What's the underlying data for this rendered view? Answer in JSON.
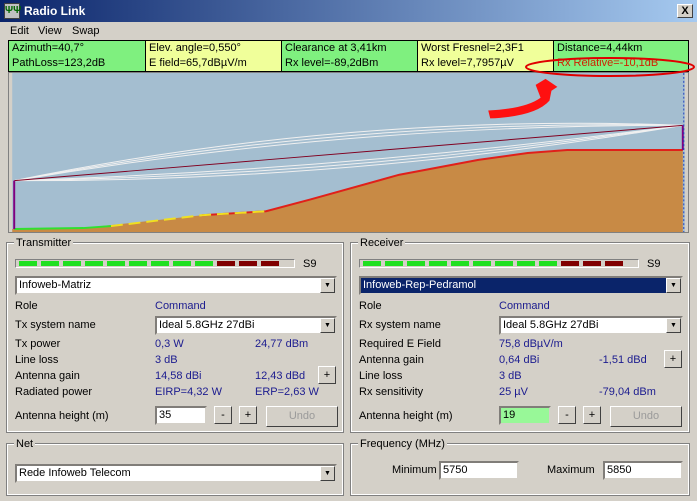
{
  "window": {
    "title": "Radio Link",
    "close": "X"
  },
  "menu": [
    "Edit",
    "View",
    "Swap"
  ],
  "info": {
    "row1": [
      "Azimuth=40,7°",
      "Elev. angle=0,550°",
      "Clearance at 3,41km",
      "Worst Fresnel=2,3F1",
      "Distance=4,44km"
    ],
    "row2": [
      "PathLoss=123,2dB",
      "E field=65,7dBµV/m",
      "Rx level=-89,2dBm",
      "Rx level=7,7957µV",
      "Rx Relative=-10,1dB"
    ]
  },
  "colors": {
    "sky": "#a4bed0",
    "terrain": "#c88a45",
    "terrain_line": "#e0201a",
    "annotation": "#ff0000"
  },
  "transmitter": {
    "legend": "Transmitter",
    "meter_label": "S9",
    "meter_green": 9,
    "meter_red": 3,
    "site": "Infoweb-Matriz",
    "role_label": "Role",
    "role": "Command",
    "system_label": "Tx system name",
    "system": "Ideal 5.8GHz 27dBi",
    "power_label": "Tx power",
    "power_w": "0,3 W",
    "power_dbm": "24,77 dBm",
    "loss_label": "Line loss",
    "loss": "3 dB",
    "gain_label": "Antenna gain",
    "gain_dbi": "14,58 dBi",
    "gain_dbd": "12,43 dBd",
    "rad_label": "Radiated power",
    "eirp": "EIRP=4,32 W",
    "erp": "ERP=2,63 W",
    "height_label": "Antenna height (m)",
    "height": "35",
    "minus": "-",
    "plus": "+",
    "undo": "Undo"
  },
  "receiver": {
    "legend": "Receiver",
    "meter_label": "S9",
    "meter_green": 9,
    "meter_red": 3,
    "site": "Infoweb-Rep-Pedramol",
    "role_label": "Role",
    "role": "Command",
    "system_label": "Rx system name",
    "system": "Ideal 5.8GHz 27dBi",
    "field_label": "Required E Field",
    "field": "75,8 dBµV/m",
    "gain_label": "Antenna gain",
    "gain_dbi": "0,64 dBi",
    "gain_dbd": "-1,51 dBd",
    "loss_label": "Line loss",
    "loss": "3 dB",
    "sens_label": "Rx sensitivity",
    "sens_uv": "25 µV",
    "sens_dbm": "-79,04 dBm",
    "height_label": "Antenna height (m)",
    "height": "19",
    "minus": "-",
    "plus": "+",
    "undo": "Undo"
  },
  "net": {
    "legend": "Net",
    "value": "Rede Infoweb Telecom"
  },
  "frequency": {
    "legend": "Frequency (MHz)",
    "min_label": "Minimum",
    "min": "5750",
    "max_label": "Maximum",
    "max": "5850"
  }
}
